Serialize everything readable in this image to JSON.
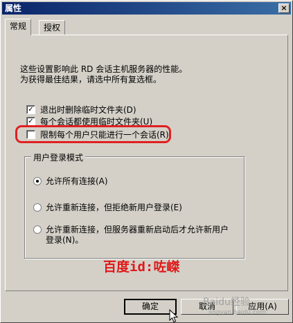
{
  "window": {
    "title": "属性",
    "close_label": "×"
  },
  "tabs": [
    {
      "label": "常规",
      "active": true
    },
    {
      "label": "授权",
      "active": false
    }
  ],
  "description": {
    "line1": "这些设置影响此 RD 会话主机服务器的性能。",
    "line2": "为获得最佳结果，请选中所有复选框。"
  },
  "options": [
    {
      "label": "退出时删除临时文件夹(D)",
      "checked": true
    },
    {
      "label": "每个会话都使用临时文件夹(U)",
      "checked": true
    },
    {
      "label": "限制每个用户只能进行一个会话(R)",
      "checked": false
    }
  ],
  "login_mode": {
    "title": "用户登录模式",
    "options": [
      {
        "label": "允许所有连接(A)",
        "selected": true
      },
      {
        "label": "允许重新连接，但拒绝新用户登录(E)",
        "selected": false
      },
      {
        "label": "允许重新连接，但服务器重新启动后才允许新用户登录(N)。",
        "selected": false
      }
    ]
  },
  "watermark": "百度id:咗嵥",
  "buttons": {
    "ok": "确定",
    "cancel": "取消",
    "apply": "应用(A)"
  },
  "site_watermark": {
    "line1": "Baidu经验",
    "line2": "jingyan.baidu.com"
  },
  "colors": {
    "highlight": "#e02020",
    "titlebar": "#0a246a",
    "watermark": "#e01818"
  }
}
